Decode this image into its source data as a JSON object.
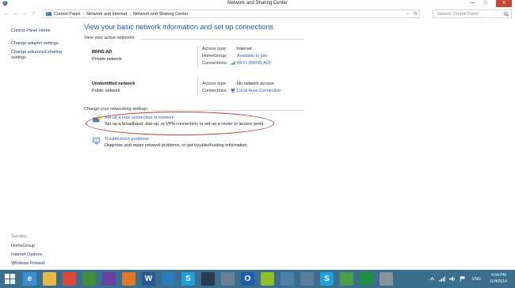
{
  "window": {
    "title": "Network and Sharing Center",
    "minimize": "—",
    "maximize": "□",
    "close": "✕"
  },
  "nav": {
    "back": "←",
    "forward": "→",
    "recent": "⌄",
    "up": "↑",
    "breadcrumb": [
      "Control Panel",
      "Network and Internet",
      "Network and Sharing Center"
    ],
    "separator": "›",
    "dropdown": "⌄",
    "refresh": "↻",
    "search_placeholder": "Search Control Panel"
  },
  "left_pane": {
    "items": [
      {
        "label": "Control Panel Home"
      },
      {
        "label": "Change adapter settings"
      },
      {
        "label": "Change advanced sharing"
      },
      {
        "label": "settings"
      }
    ],
    "see_also_label": "See also",
    "see_also": [
      {
        "label": "HomeGroup"
      },
      {
        "label": "Internet Options"
      },
      {
        "label": "Windows Firewall"
      }
    ]
  },
  "main": {
    "title": "View your basic network information and set up connections",
    "active_networks_heading": "View your active networks",
    "networks": [
      {
        "name": "BRNS-AD",
        "type": "Private network",
        "fields": [
          {
            "label": "Access type:",
            "value": "Internet",
            "link": false
          },
          {
            "label": "HomeGroup:",
            "value": "Available to join",
            "link": true
          },
          {
            "label": "Connections:",
            "value": "Wi-Fi (BRNS-AD)",
            "link": true,
            "icon": "wifi-icon"
          }
        ]
      },
      {
        "name": "Unidentified network",
        "type": "Public network",
        "fields": [
          {
            "label": "Access type:",
            "value": "No network access",
            "link": false
          },
          {
            "label": "Connections:",
            "value": "Local Area Connection",
            "link": true,
            "icon": "lan-icon"
          }
        ]
      }
    ],
    "settings_heading": "Change your networking settings",
    "tasks": [
      {
        "link": "Set up a new connection or network",
        "description": "Set up a broadband, dial-up, or VPN connection; or set up a router or access point.",
        "icon": "new-connection-icon"
      },
      {
        "link": "Troubleshoot problems",
        "description": "Diagnose and repair network problems, or get troubleshooting information.",
        "icon": "troubleshoot-icon"
      }
    ]
  },
  "taskbar": {
    "apps": [
      {
        "name": "start-button",
        "color": "#3c6e8e",
        "glyph": ""
      },
      {
        "name": "internet-explorer-icon",
        "color": "#3a8fd6",
        "glyph": "e"
      },
      {
        "name": "file-explorer-icon",
        "color": "#e8b84a",
        "glyph": ""
      },
      {
        "name": "chrome-icon",
        "color": "#d94a3a",
        "glyph": ""
      },
      {
        "name": "app-green-icon",
        "color": "#3f8f3a",
        "glyph": ""
      },
      {
        "name": "yahoo-messenger-icon",
        "color": "#6b3fa0",
        "glyph": ""
      },
      {
        "name": "firefox-icon",
        "color": "#e07a2a",
        "glyph": ""
      },
      {
        "name": "word-icon",
        "color": "#2b5797",
        "glyph": "W"
      },
      {
        "name": "app-blue-icon",
        "color": "#2d7bbf",
        "glyph": ""
      },
      {
        "name": "skype-icon",
        "color": "#1fa0dc",
        "glyph": "S"
      },
      {
        "name": "app-dark-icon",
        "color": "#2a3b4c",
        "glyph": ""
      },
      {
        "name": "app-photo-icon",
        "color": "#6a7f92",
        "glyph": ""
      },
      {
        "name": "outlook-icon",
        "color": "#1f5fa8",
        "glyph": "O"
      },
      {
        "name": "app-lime-icon",
        "color": "#8fbf2a",
        "glyph": ""
      },
      {
        "name": "network-center-icon",
        "color": "#4d7fa8",
        "glyph": ""
      },
      {
        "name": "app-monitor-icon",
        "color": "#5a7f9e",
        "glyph": ""
      },
      {
        "name": "skype-active-icon",
        "color": "#1fa0dc",
        "glyph": "S"
      },
      {
        "name": "app-green2-icon",
        "color": "#4aa04a",
        "glyph": ""
      },
      {
        "name": "app-green3-icon",
        "color": "#1f8f3f",
        "glyph": ""
      },
      {
        "name": "app-gray-icon",
        "color": "#8a949e",
        "glyph": ""
      }
    ],
    "tray": {
      "language": "ENG",
      "time": "4:04 PM",
      "date": "11/4/2014"
    }
  },
  "colors": {
    "link": "#2a62b8",
    "title": "#1f5aa8",
    "highlight": "#c23a3a",
    "taskbar": "#3c6e8e"
  }
}
